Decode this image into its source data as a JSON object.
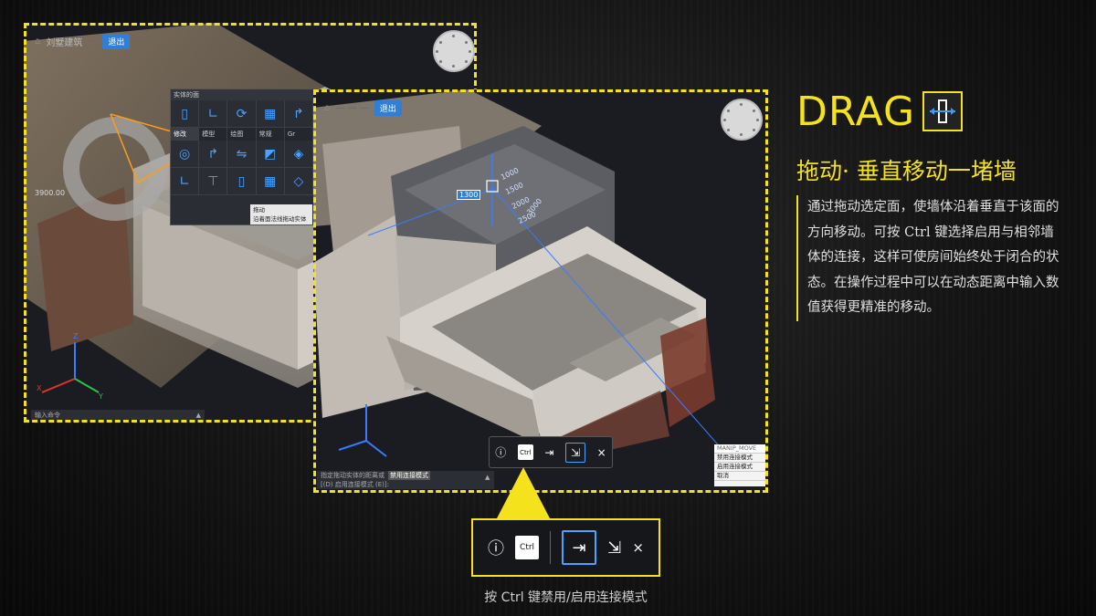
{
  "colors": {
    "accent": "#f4e21c",
    "blue": "#2f7fd6",
    "axis_x": "#e0342c",
    "axis_y": "#2ec04a",
    "axis_z": "#3a7bff"
  },
  "left_viewport": {
    "breadcrumb": "刘墅建筑",
    "exit_label": "退出",
    "coord_readout": "3900.00",
    "command_placeholder": "输入命令",
    "palette": {
      "title": "实体的面",
      "tabs": [
        "修改",
        "模型",
        "绘图",
        "常规",
        "Gr"
      ],
      "tooltip_title": "拖动",
      "tooltip_desc": "沿着面法线拖动实体"
    }
  },
  "right_viewport": {
    "exit_label": "退出",
    "dim_label": "1300",
    "dims": [
      "1000",
      "1500",
      "2000",
      "2500",
      "3000"
    ],
    "command_line1": "指定拖动实体的距离或",
    "command_line1_option": "禁用连接模式",
    "command_line2": "[(D) 启用连接模式 (E)]:",
    "manip_menu": {
      "header": "MANIP_MOVE",
      "items": [
        "禁用连接模式",
        "启用连接模式",
        "取消"
      ]
    }
  },
  "toolbar": {
    "info_icon": "info-icon",
    "ctrl_label": "Ctrl",
    "close_label": "×"
  },
  "caption": "按 Ctrl 键禁用/启用连接模式",
  "right_panel": {
    "title": "DRAG",
    "subtitle": "拖动·  垂直移动一堵墙",
    "description": "通过拖动选定面，使墙体沿着垂直于该面的方向移动。可按 Ctrl 键选择启用与相邻墙体的连接，这样可使房间始终处于闭合的状态。在操作过程中可以在动态距离中输入数值获得更精准的移动。"
  }
}
